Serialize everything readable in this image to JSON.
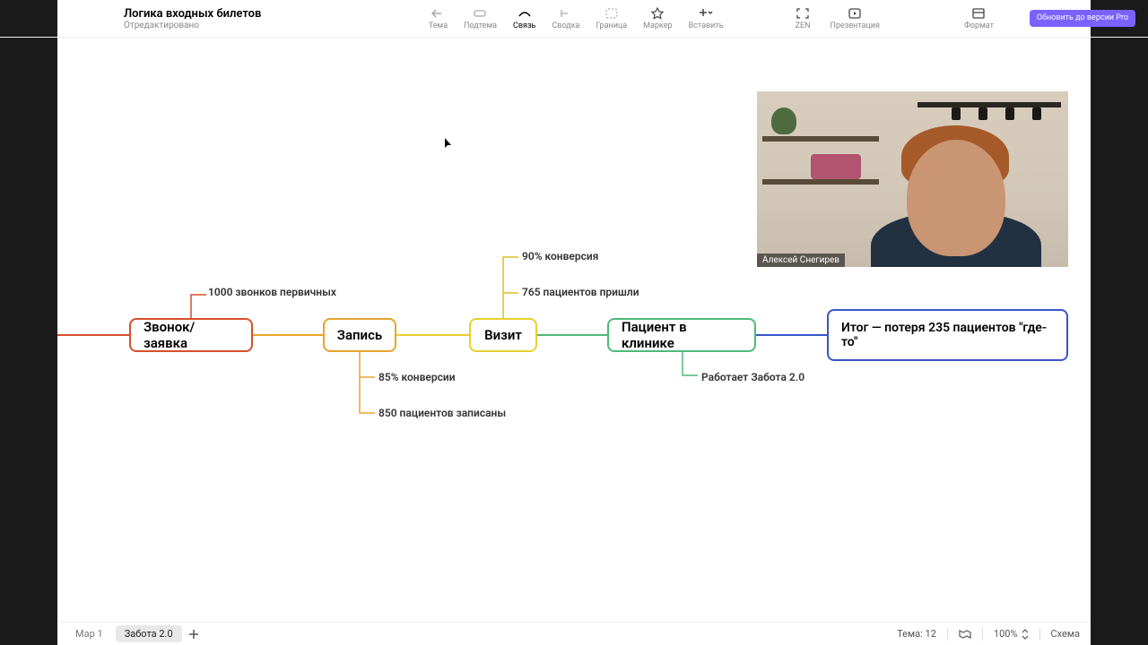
{
  "header": {
    "title": "Логика входных билетов",
    "subtitle": "Отредактировано"
  },
  "toolbar": {
    "theme": "Тема",
    "subtopic": "Подтема",
    "link": "Связь",
    "summary": "Сводка",
    "border": "Граница",
    "marker": "Маркер",
    "insert": "Вставить",
    "zen": "ZEN",
    "presentation": "Презентация",
    "format": "Формат",
    "upgrade": "Обновить до версии Pro"
  },
  "nodes": {
    "n1": {
      "label": "Звонок/заявка",
      "color": "#d64f2a"
    },
    "n2": {
      "label": "Запись",
      "color": "#e8a32f"
    },
    "n3": {
      "label": "Визит",
      "color": "#e8cf2f"
    },
    "n4": {
      "label": "Пациент в клинике",
      "color": "#4fb97a"
    },
    "n5": {
      "label": "Итог — потеря 235 пациентов \"где-то\"",
      "color": "#3755c9"
    }
  },
  "notes": {
    "a1": {
      "text": "1000 звонков первичных",
      "color": "#d64f2a"
    },
    "a2": {
      "text": "85% конверсии",
      "color": "#e8a32f"
    },
    "a3": {
      "text": "850 пациентов записаны",
      "color": "#e8a32f"
    },
    "a4": {
      "text": "90% конверсия",
      "color": "#d8c028"
    },
    "a5": {
      "text": "765 пациентов пришли",
      "color": "#d8c028"
    },
    "a6": {
      "text": "Работает Забота 2.0",
      "color": "#4fb97a"
    }
  },
  "webcam": {
    "presenter": "Алексей Снегирев"
  },
  "bottom": {
    "tab1": "Map 1",
    "tab2": "Забота 2.0",
    "topics": "Тема: 12",
    "zoom": "100%",
    "scheme": "Схема"
  }
}
